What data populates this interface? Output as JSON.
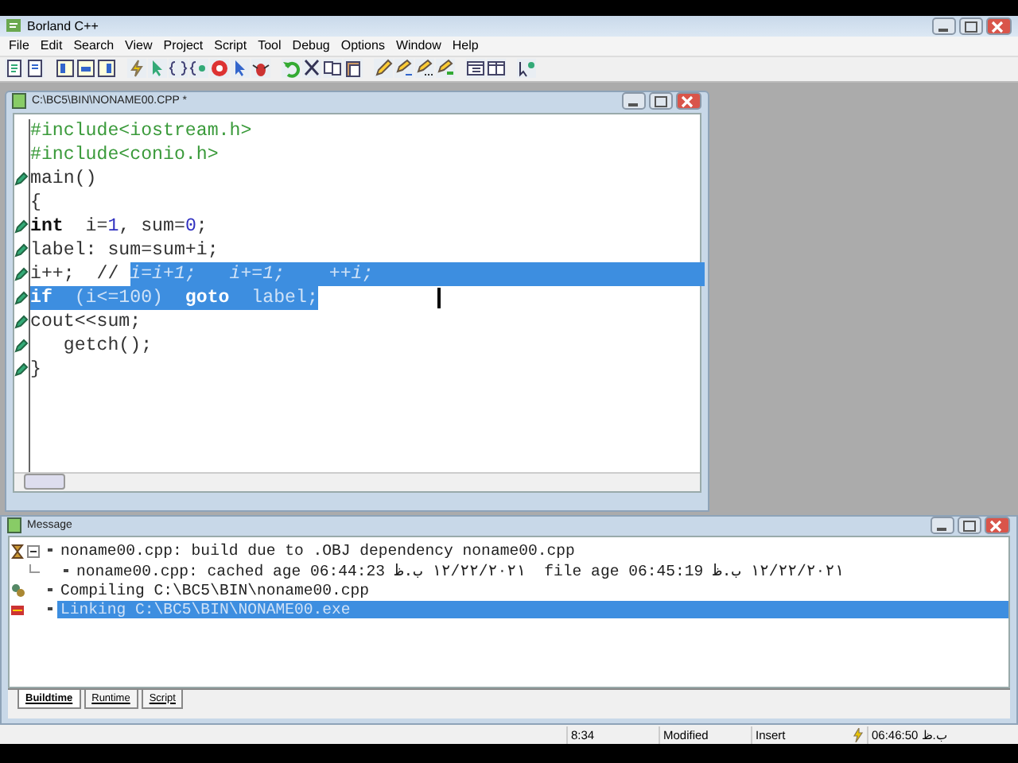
{
  "app": {
    "title": "Borland C++"
  },
  "menu": [
    "File",
    "Edit",
    "Search",
    "View",
    "Project",
    "Script",
    "Tool",
    "Debug",
    "Options",
    "Window",
    "Help"
  ],
  "editor": {
    "title": "C:\\BC5\\BIN\\NONAME00.CPP *",
    "lines": [
      {
        "marked": false,
        "segments": [
          {
            "text": "#include<iostream.h>",
            "kind": "directive",
            "selected": false
          }
        ]
      },
      {
        "marked": false,
        "segments": [
          {
            "text": "#include<conio.h>",
            "kind": "directive",
            "selected": false
          }
        ]
      },
      {
        "marked": true,
        "segments": [
          {
            "text": "main()",
            "kind": "plain",
            "selected": false
          }
        ]
      },
      {
        "marked": false,
        "segments": [
          {
            "text": "{",
            "kind": "plain",
            "selected": false
          }
        ]
      },
      {
        "marked": true,
        "segments": [
          {
            "text": "int",
            "kind": "keyword",
            "selected": false
          },
          {
            "text": "  i=",
            "kind": "plain",
            "selected": false
          },
          {
            "text": "1",
            "kind": "number",
            "selected": false
          },
          {
            "text": ", sum=",
            "kind": "plain",
            "selected": false
          },
          {
            "text": "0",
            "kind": "number",
            "selected": false
          },
          {
            "text": ";",
            "kind": "plain",
            "selected": false
          }
        ]
      },
      {
        "marked": true,
        "segments": [
          {
            "text": "label: sum=sum+i;",
            "kind": "plain",
            "selected": false
          }
        ]
      },
      {
        "marked": true,
        "segments": [
          {
            "text": "i++;  // ",
            "kind": "plain",
            "selected": false
          },
          {
            "text": "i=i+1;   i+=1;    ++i;",
            "kind": "comment",
            "selected": true
          }
        ]
      },
      {
        "marked": true,
        "segments": [
          {
            "text": "if",
            "kind": "keyword",
            "selected": true
          },
          {
            "text": "  (i<=",
            "kind": "plain",
            "selected": true
          },
          {
            "text": "100",
            "kind": "number",
            "selected": true
          },
          {
            "text": ")  ",
            "kind": "plain",
            "selected": true
          },
          {
            "text": "goto",
            "kind": "keyword",
            "selected": true
          },
          {
            "text": "  label;",
            "kind": "plain",
            "selected": true
          }
        ]
      },
      {
        "marked": true,
        "segments": [
          {
            "text": "cout<<sum;",
            "kind": "plain",
            "selected": false
          }
        ]
      },
      {
        "marked": true,
        "segments": [
          {
            "text": "   getch();",
            "kind": "plain",
            "selected": false
          }
        ]
      },
      {
        "marked": true,
        "segments": [
          {
            "text": "}",
            "kind": "plain",
            "selected": false
          }
        ]
      }
    ]
  },
  "messages": {
    "title": "Message",
    "items": [
      {
        "kind": "build",
        "text": "noname00.cpp: build due to .OBJ dependency noname00.cpp",
        "selected": false,
        "expanded": true,
        "children": [
          {
            "text": "noname00.cpp: cached age 06:44:23 ١٢/٢٢/٢٠٢١ ب.ظ  file age 06:45:19 ١٢/٢٢/٢٠٢١ ب.ظ",
            "selected": false
          }
        ]
      },
      {
        "kind": "compile",
        "text": "Compiling C:\\BC5\\BIN\\noname00.cpp",
        "selected": false
      },
      {
        "kind": "link",
        "text": "Linking C:\\BC5\\BIN\\NONAME00.exe",
        "selected": true
      }
    ],
    "tabs": [
      {
        "label": "Buildtime",
        "selected": true
      },
      {
        "label": "Runtime",
        "selected": false
      },
      {
        "label": "Script",
        "selected": false
      }
    ]
  },
  "status_bar": {
    "position": "8:34",
    "modified": "Modified",
    "mode": "Insert",
    "time": "06:46:50 ب.ظ"
  }
}
